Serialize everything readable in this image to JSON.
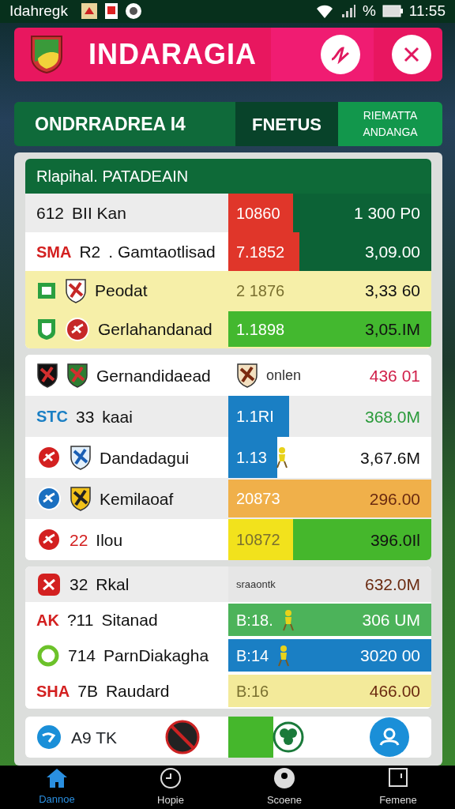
{
  "status_bar": {
    "carrier": "Idahregk",
    "percent": "%",
    "time": "11:55"
  },
  "header": {
    "title": "INDARAGIA"
  },
  "tabs": [
    {
      "label": "ONDRRADREA I4",
      "selected": false
    },
    {
      "label": "FNETUS",
      "selected": true
    },
    {
      "label": "RIEMATTA ANDANGA",
      "selected": false
    }
  ],
  "cards": [
    {
      "title": "Rlapihal. PATADEAIN",
      "rows": [
        {
          "number": "612",
          "name": "BII Kan",
          "value": "10860",
          "color": "#e0362a",
          "level": 0.32,
          "amount": "1 300 P0"
        },
        {
          "badge": "SMA",
          "number": "R2",
          "name": ". Gamtaotlisad",
          "value": "7.1852",
          "color": "#e0362a",
          "level": 0.35,
          "amount": "3,09.00"
        },
        {
          "name": "Peodat",
          "value": "2 1876",
          "amount": "3,33 60"
        },
        {
          "name": "Gerlahandanad",
          "value": "1.1898",
          "color": "#43b82f",
          "level": 1,
          "amount": "3,05.IM"
        }
      ]
    },
    {
      "rows": [
        {
          "name": "Gernandidaead",
          "note": "onlen",
          "amount": "436 01"
        },
        {
          "badge": "STC",
          "number": "33",
          "name": "kaai",
          "value": "1.1RI",
          "color": "#1a7fc4",
          "level": 0.3,
          "amount": "368.0M"
        },
        {
          "name": "Dandadagui",
          "value": "1.13",
          "color": "#1a7fc4",
          "level": 0.24,
          "amount": "3,67.6M"
        },
        {
          "name": "Kemilaoaf",
          "value": "20873",
          "color": "#f0b04a",
          "level": 1,
          "amount": "296.00"
        },
        {
          "number": "22",
          "name": "Ilou",
          "value": "10872",
          "color": "#f2e21c",
          "level": 0.32,
          "amount": "396.0Il"
        }
      ]
    },
    {
      "rows": [
        {
          "number": "32",
          "name": "Rkal",
          "note": "sraaontk",
          "amount": "632.0M"
        },
        {
          "badge": "AK",
          "number": "?11",
          "name": "Sitanad",
          "value": "B:18.",
          "color": "#4cb35a",
          "level": 1,
          "amount": "306 UM"
        },
        {
          "number": "714",
          "name": "ParnDiakagha",
          "value": "B:14",
          "color": "#1a7fc4",
          "level": 1,
          "amount": "3020 00"
        },
        {
          "badge": "SHA",
          "number": "7B",
          "name": "Raudard",
          "value": "B:16",
          "color": "#f3ea9a",
          "level": 1,
          "amount": "466.00"
        }
      ]
    }
  ],
  "action_bar": {
    "label": "A9 TK"
  },
  "bottom_nav": [
    {
      "label": "Dannoe",
      "selected": true
    },
    {
      "label": "Hopie",
      "selected": false
    },
    {
      "label": "Scoene",
      "selected": false
    },
    {
      "label": "Femene",
      "selected": false
    }
  ]
}
